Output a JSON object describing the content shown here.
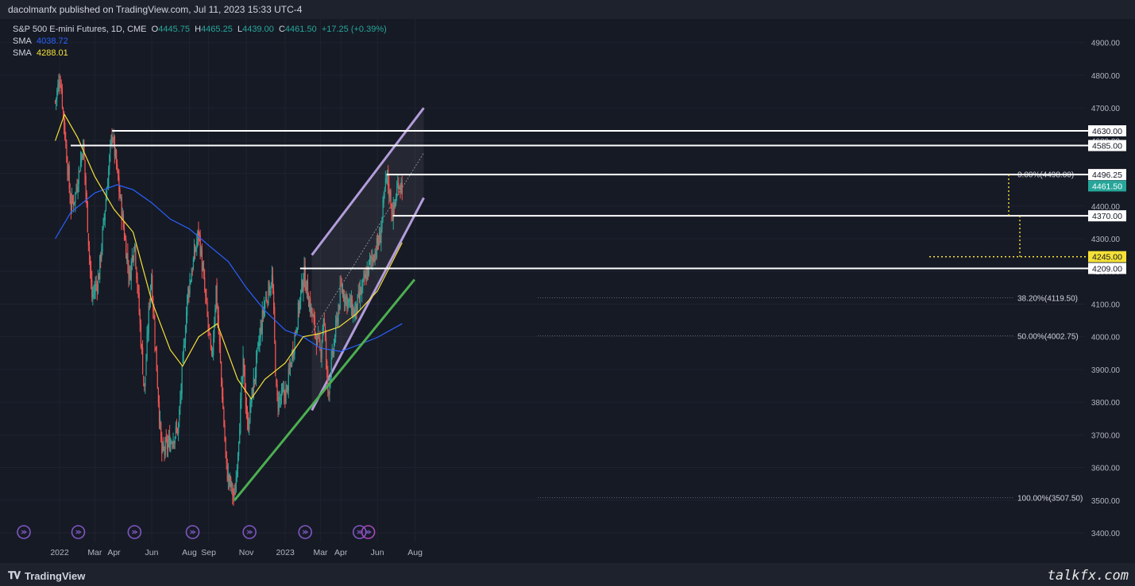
{
  "header": {
    "publisher_line": "dacolmanfx published on TradingView.com, Jul 11, 2023 15:33 UTC-4"
  },
  "legend": {
    "symbol": "S&P 500 E-mini Futures, 1D, CME",
    "open_label": "O",
    "open": "4445.75",
    "high_label": "H",
    "high": "4465.25",
    "low_label": "L",
    "low": "4439.00",
    "close_label": "C",
    "close": "4461.50",
    "change": "+17.25 (+0.39%)",
    "sma1_label": "SMA",
    "sma1_value": "4038.72",
    "sma2_label": "SMA",
    "sma2_value": "4288.01"
  },
  "footer": {
    "brand": "TradingView",
    "watermark": "talkfx.com"
  },
  "colors": {
    "background": "#161a25",
    "up": "#26a69a",
    "down": "#ef5350",
    "sma_blue": "#2962ff",
    "sma_yellow": "#f5e038",
    "channel": "#b39ddb",
    "trendline": "#4caf50",
    "level_line": "#ffffff"
  },
  "chart_data": {
    "type": "candlestick",
    "y_axis": {
      "ticks": [
        3400,
        3500,
        3600,
        3700,
        3800,
        3900,
        4000,
        4100,
        4200,
        4300,
        4400,
        4500,
        4600,
        4700,
        4800,
        4900
      ],
      "tick_labels": [
        "3400.00",
        "3500.00",
        "3600.00",
        "3700.00",
        "3800.00",
        "3900.00",
        "4000.00",
        "4100.00",
        "4200.00",
        "4300.00",
        "4400.00",
        "4500.00",
        "4600.00",
        "4700.00",
        "4800.00",
        "4900.00"
      ]
    },
    "x_axis": {
      "labels": [
        "2022",
        "Mar",
        "Apr",
        "Jun",
        "Aug",
        "Sep",
        "Nov",
        "2023",
        "Mar",
        "Apr",
        "Jun",
        "Aug"
      ],
      "dates": [
        "2022-01-03",
        "2022-03-01",
        "2022-04-01",
        "2022-06-01",
        "2022-08-01",
        "2022-09-01",
        "2022-11-01",
        "2023-01-03",
        "2023-03-01",
        "2023-04-03",
        "2023-06-01",
        "2023-08-01"
      ]
    },
    "price_path": [
      [
        "2021-12-27",
        4720
      ],
      [
        "2022-01-04",
        4800
      ],
      [
        "2022-01-21",
        4400
      ],
      [
        "2022-01-28",
        4430
      ],
      [
        "2022-02-10",
        4590
      ],
      [
        "2022-02-24",
        4120
      ],
      [
        "2022-03-07",
        4180
      ],
      [
        "2022-03-29",
        4630
      ],
      [
        "2022-04-26",
        4180
      ],
      [
        "2022-05-04",
        4300
      ],
      [
        "2022-05-20",
        3830
      ],
      [
        "2022-05-31",
        4200
      ],
      [
        "2022-06-17",
        3640
      ],
      [
        "2022-07-14",
        3720
      ],
      [
        "2022-07-29",
        4130
      ],
      [
        "2022-08-16",
        4325
      ],
      [
        "2022-09-06",
        3920
      ],
      [
        "2022-09-13",
        4150
      ],
      [
        "2022-09-30",
        3590
      ],
      [
        "2022-10-13",
        3500
      ],
      [
        "2022-10-27",
        3920
      ],
      [
        "2022-11-03",
        3720
      ],
      [
        "2022-11-30",
        4100
      ],
      [
        "2022-12-13",
        4180
      ],
      [
        "2022-12-20",
        3800
      ],
      [
        "2023-01-05",
        3830
      ],
      [
        "2023-02-02",
        4195
      ],
      [
        "2023-02-22",
        4000
      ],
      [
        "2023-03-01",
        3950
      ],
      [
        "2023-03-06",
        4070
      ],
      [
        "2023-03-13",
        3830
      ],
      [
        "2023-04-03",
        4150
      ],
      [
        "2023-04-25",
        4070
      ],
      [
        "2023-05-19",
        4220
      ],
      [
        "2023-06-05",
        4300
      ],
      [
        "2023-06-16",
        4498
      ],
      [
        "2023-06-26",
        4370
      ],
      [
        "2023-07-05",
        4475
      ],
      [
        "2023-07-11",
        4461.5
      ]
    ],
    "last_candle": {
      "open": 4445.75,
      "high": 4465.25,
      "low": 4439.0,
      "close": 4461.5,
      "change": 17.25,
      "change_pct": 0.39
    },
    "indicators": [
      {
        "name": "SMA",
        "value": 4038.72,
        "color": "#2962ff",
        "path": [
          [
            "2021-12-27",
            4300
          ],
          [
            "2022-01-21",
            4380
          ],
          [
            "2022-03-01",
            4440
          ],
          [
            "2022-04-06",
            4465
          ],
          [
            "2022-05-02",
            4450
          ],
          [
            "2022-06-01",
            4410
          ],
          [
            "2022-07-01",
            4360
          ],
          [
            "2022-08-01",
            4330
          ],
          [
            "2022-09-01",
            4280
          ],
          [
            "2022-10-03",
            4230
          ],
          [
            "2022-11-01",
            4150
          ],
          [
            "2022-12-01",
            4080
          ],
          [
            "2023-01-03",
            4020
          ],
          [
            "2023-02-01",
            4000
          ],
          [
            "2023-03-01",
            3965
          ],
          [
            "2023-04-03",
            3955
          ],
          [
            "2023-05-01",
            3975
          ],
          [
            "2023-06-01",
            3998
          ],
          [
            "2023-07-11",
            4040
          ]
        ]
      },
      {
        "name": "SMA",
        "value": 4288.01,
        "color": "#f5e038",
        "path": [
          [
            "2021-12-27",
            4600
          ],
          [
            "2022-01-11",
            4680
          ],
          [
            "2022-02-01",
            4610
          ],
          [
            "2022-03-01",
            4490
          ],
          [
            "2022-04-01",
            4390
          ],
          [
            "2022-05-02",
            4320
          ],
          [
            "2022-06-01",
            4110
          ],
          [
            "2022-07-01",
            3960
          ],
          [
            "2022-07-21",
            3910
          ],
          [
            "2022-08-16",
            4000
          ],
          [
            "2022-09-15",
            4040
          ],
          [
            "2022-10-18",
            3870
          ],
          [
            "2022-11-09",
            3810
          ],
          [
            "2022-12-01",
            3870
          ],
          [
            "2023-01-03",
            3920
          ],
          [
            "2023-02-01",
            4000
          ],
          [
            "2023-02-28",
            4010
          ],
          [
            "2023-03-31",
            4030
          ],
          [
            "2023-04-28",
            4070
          ],
          [
            "2023-06-01",
            4140
          ],
          [
            "2023-07-11",
            4288
          ]
        ]
      }
    ],
    "horizontal_levels": [
      {
        "price": 4630,
        "label": "4630.00",
        "from": "2022-03-29"
      },
      {
        "price": 4585,
        "label": "4585.00",
        "from": "2022-01-21"
      },
      {
        "price": 4496.25,
        "label": "4496.25",
        "from": "2023-06-16"
      },
      {
        "price": 4370,
        "label": "4370.00",
        "from": "2023-06-26"
      },
      {
        "price": 4209,
        "label": "4209.00",
        "from": "2023-01-27"
      }
    ],
    "highlight_levels": [
      {
        "price": 4245,
        "label": "4245.00"
      }
    ],
    "last_price_label": "4461.50",
    "fibonacci": [
      {
        "ratio_label": "0.00%",
        "price": 4498.0,
        "text": "0.00%(4498.00)"
      },
      {
        "ratio_label": "38.20%",
        "price": 4119.5,
        "text": "38.20%(4119.50)"
      },
      {
        "ratio_label": "50.00%",
        "price": 4002.75,
        "text": "50.00%(4002.75)"
      },
      {
        "ratio_label": "100.00%",
        "price": 3507.5,
        "text": "100.00%(3507.50)"
      }
    ],
    "trendline": {
      "from": [
        "2022-10-13",
        3500
      ],
      "to": [
        "2023-07-31",
        4175
      ]
    },
    "channel": {
      "upper": {
        "from": [
          "2023-02-15",
          4250
        ],
        "to": [
          "2023-08-15",
          4700
        ]
      },
      "lower": {
        "from": [
          "2023-02-15",
          3775
        ],
        "to": [
          "2023-08-15",
          4425
        ]
      }
    },
    "event_markers": [
      "2022-01-03",
      "2022-04-01",
      "2022-07-01",
      "2022-10-03",
      "2023-01-03",
      "2023-04-03",
      "2023-06-30",
      "2023-07-14"
    ]
  }
}
